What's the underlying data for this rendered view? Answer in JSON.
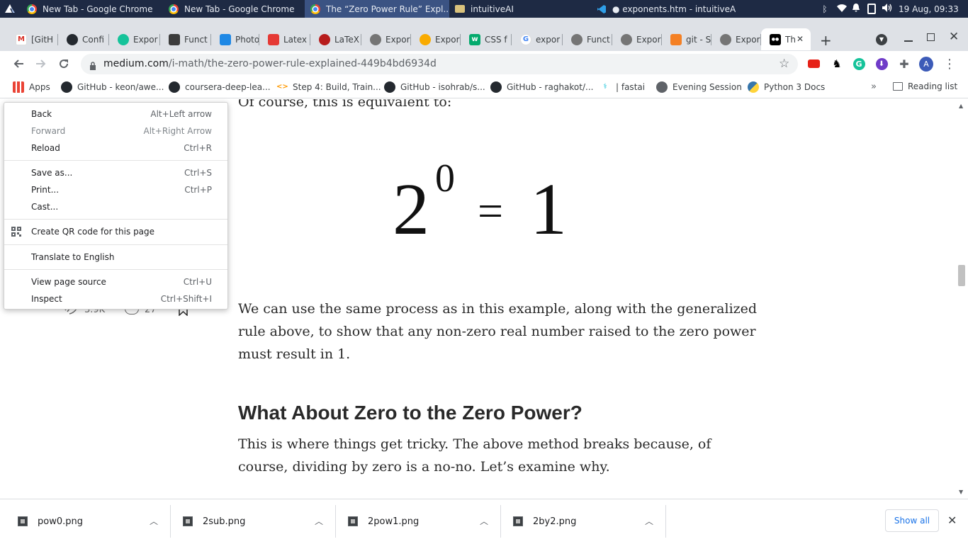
{
  "taskbar": {
    "windows": [
      {
        "label": "New Tab - Google Chrome",
        "icon": "chrome-icon"
      },
      {
        "label": "New Tab - Google Chrome",
        "icon": "chrome-icon"
      },
      {
        "label": "The “Zero Power Rule” Expl...",
        "icon": "chrome-icon"
      },
      {
        "label": "intuitiveAI",
        "icon": "folder-icon"
      },
      {
        "label": "● exponents.htm - intuitiveA...",
        "icon": "vscode-icon"
      }
    ],
    "clock": "19 Aug, 09:33"
  },
  "browser": {
    "tabs": [
      {
        "label": "[GitH",
        "icon": "gmail-icon"
      },
      {
        "label": "Confi",
        "icon": "github-icon"
      },
      {
        "label": "Expor",
        "icon": "grammarly-icon"
      },
      {
        "label": "Funct",
        "icon": "page-icon"
      },
      {
        "label": "Photo",
        "icon": "photopea-icon"
      },
      {
        "label": "Latex",
        "icon": "latex-v-icon"
      },
      {
        "label": "LaTeX",
        "icon": "latex-icon"
      },
      {
        "label": "Expor",
        "icon": "globe-icon"
      },
      {
        "label": "Expor",
        "icon": "compass-icon"
      },
      {
        "label": "CSS f",
        "icon": "w3schools-icon"
      },
      {
        "label": "expor",
        "icon": "google-icon"
      },
      {
        "label": "Funct",
        "icon": "globe-icon"
      },
      {
        "label": "Expor",
        "icon": "globe-icon"
      },
      {
        "label": "git - S",
        "icon": "stackoverflow-icon"
      },
      {
        "label": "Expor",
        "icon": "globe-icon"
      },
      {
        "label": "Th",
        "icon": "medium-icon"
      }
    ],
    "url_host": "medium.com",
    "url_path": "/i-math/the-zero-power-rule-explained-449b4bd6934d",
    "profile_initial": "A",
    "bookmarks": [
      {
        "label": "Apps",
        "icon": "apps-grid-icon"
      },
      {
        "label": "GitHub - keon/awe...",
        "icon": "github-icon"
      },
      {
        "label": "coursera-deep-lea...",
        "icon": "github-icon"
      },
      {
        "label": "Step 4: Build, Train...",
        "icon": "code-icon"
      },
      {
        "label": "GitHub - isohrab/s...",
        "icon": "github-icon"
      },
      {
        "label": "GitHub - raghakot/...",
        "icon": "github-icon"
      },
      {
        "label": "| fastai",
        "icon": "fastai-icon"
      },
      {
        "label": "Evening Session",
        "icon": "globe-icon"
      },
      {
        "label": "Python 3 Docs",
        "icon": "python-icon"
      }
    ],
    "reading_list": "Reading list"
  },
  "article": {
    "partial_line": "Of course, this is equivalent to:",
    "equation": {
      "base": "2",
      "exponent": "0",
      "equals": "=",
      "result": "1"
    },
    "paragraph1": [
      "We can use the same process as in this example, along with the generalized",
      "rule above, to show that any non-zero real number raised to the zero power",
      "must result in 1."
    ],
    "heading": "What About Zero to the Zero Power?",
    "paragraph2": [
      "This is where things get tricky. The above method breaks because, of",
      "course, dividing by zero is a no-no. Let’s examine why."
    ],
    "claps": "3.9K",
    "responses": "27"
  },
  "context_menu": {
    "items": [
      {
        "label": "Back",
        "shortcut": "Alt+Left arrow",
        "enabled": true
      },
      {
        "label": "Forward",
        "shortcut": "Alt+Right Arrow",
        "enabled": false
      },
      {
        "label": "Reload",
        "shortcut": "Ctrl+R",
        "enabled": true
      },
      {
        "label": "Save as...",
        "shortcut": "Ctrl+S",
        "enabled": true
      },
      {
        "label": "Print...",
        "shortcut": "Ctrl+P",
        "enabled": true
      },
      {
        "label": "Cast...",
        "shortcut": "",
        "enabled": true
      },
      {
        "label": "Create QR code for this page",
        "shortcut": "",
        "enabled": true
      },
      {
        "label": "Translate to English",
        "shortcut": "",
        "enabled": true
      },
      {
        "label": "View page source",
        "shortcut": "Ctrl+U",
        "enabled": true
      },
      {
        "label": "Inspect",
        "shortcut": "Ctrl+Shift+I",
        "enabled": true
      }
    ]
  },
  "downloads": {
    "items": [
      "pow0.png",
      "2sub.png",
      "2pow1.png",
      "2by2.png"
    ],
    "show_all": "Show all"
  }
}
